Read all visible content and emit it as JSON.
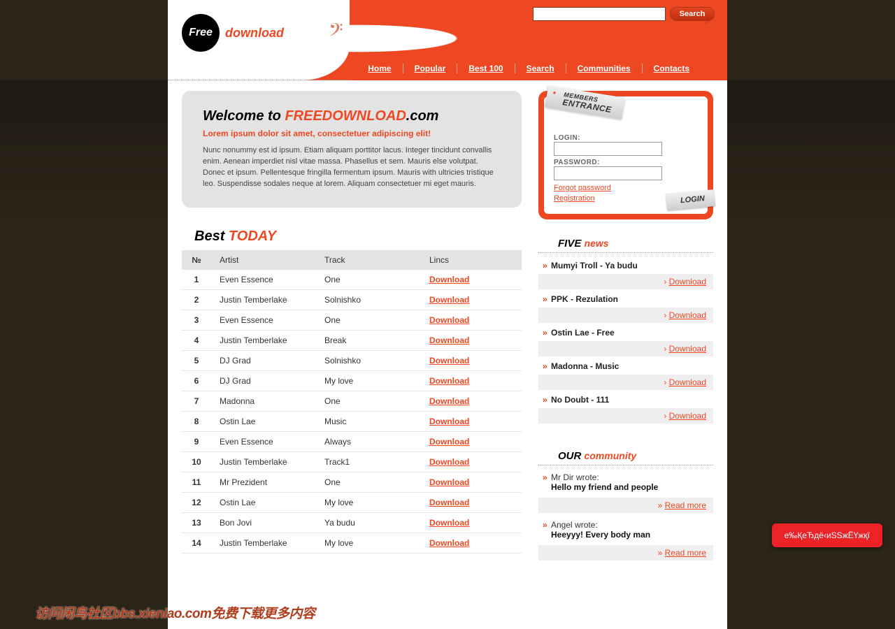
{
  "searchbar": {
    "button": "Search",
    "placeholder": ""
  },
  "logo": {
    "circle": "Free",
    "text": "download"
  },
  "nav": [
    "Home",
    "Popular",
    "Best 100",
    "Search",
    "Communities",
    "Contacts"
  ],
  "welcome": {
    "title_pre": "Welcome to ",
    "title_accent": "FREEDOWNLOAD",
    "title_post": ".com",
    "sub": "Lorem ipsum dolor sit amet, consectetuer adipiscing elit!",
    "body": "Nunc nonummy est id ipsum. Etiam aliquam porttitor lacus. Integer tincidunt convallis enim. Aenean imperdiet nisl vitae massa. Phasellus et sem. Mauris else volutpat. Donec et ipsum. Pellentesque fringilla fermentum ipsum. Mauris with ultricies tristique leo. Suspendisse sodales neque at lorem. Aliquam consectetuer mi eget mauris."
  },
  "best_today": {
    "title_pre": "Best ",
    "title_accent": "TODAY",
    "columns": {
      "no": "№",
      "artist": "Artist",
      "track": "Track",
      "links": "Lincs"
    },
    "download_label": "Download",
    "rows": [
      {
        "n": "1",
        "artist": "Even Essence",
        "track": "One"
      },
      {
        "n": "2",
        "artist": "Justin Temberlake",
        "track": "Solnishko"
      },
      {
        "n": "3",
        "artist": "Even Essence",
        "track": "One"
      },
      {
        "n": "4",
        "artist": "Justin Temberlake",
        "track": "Break"
      },
      {
        "n": "5",
        "artist": "DJ Grad",
        "track": "Solnishko"
      },
      {
        "n": "6",
        "artist": "DJ Grad",
        "track": "My love"
      },
      {
        "n": "7",
        "artist": "Madonna",
        "track": "One"
      },
      {
        "n": "8",
        "artist": "Ostin Lae",
        "track": "Music"
      },
      {
        "n": "9",
        "artist": "Even Essence",
        "track": "Always"
      },
      {
        "n": "10",
        "artist": "Justin Temberlake",
        "track": "Track1"
      },
      {
        "n": "11",
        "artist": "Mr Prezident",
        "track": "One"
      },
      {
        "n": "12",
        "artist": "Ostin Lae",
        "track": "My love"
      },
      {
        "n": "13",
        "artist": "Bon Jovi",
        "track": "Ya budu"
      },
      {
        "n": "14",
        "artist": "Justin Temberlake",
        "track": "My love"
      }
    ]
  },
  "login": {
    "badge_top": "MEMBERS",
    "badge_bottom": "ENTRANCE",
    "login_label": "LOGIN:",
    "password_label": "PASSWORD:",
    "login_value": "",
    "password_value": "",
    "forgot": "Forgot password",
    "register": "Registration",
    "button": "LOGIN"
  },
  "five_news": {
    "title_pre": "FIVE ",
    "title_accent": "news",
    "download_label": "Download",
    "items": [
      "Mumyi Troll - Ya budu",
      "PPK - Rezulation",
      "Ostin Lae - Free",
      "Madonna - Music",
      "No Doubt - 111"
    ]
  },
  "community": {
    "title_pre": "OUR ",
    "title_accent": "community",
    "readmore": "Read more",
    "items": [
      {
        "author": "Mr Dir wrote:",
        "text": "Hello my friend and people"
      },
      {
        "author": "Angel wrote:",
        "text": "Heeyyy! Every body man"
      }
    ]
  },
  "watermark": "访问闲鸟社区bbs.xieniao.com免费下载更多内容",
  "pill": "е‰ҚеЂдё‹иЅЅжЁҮжқї"
}
